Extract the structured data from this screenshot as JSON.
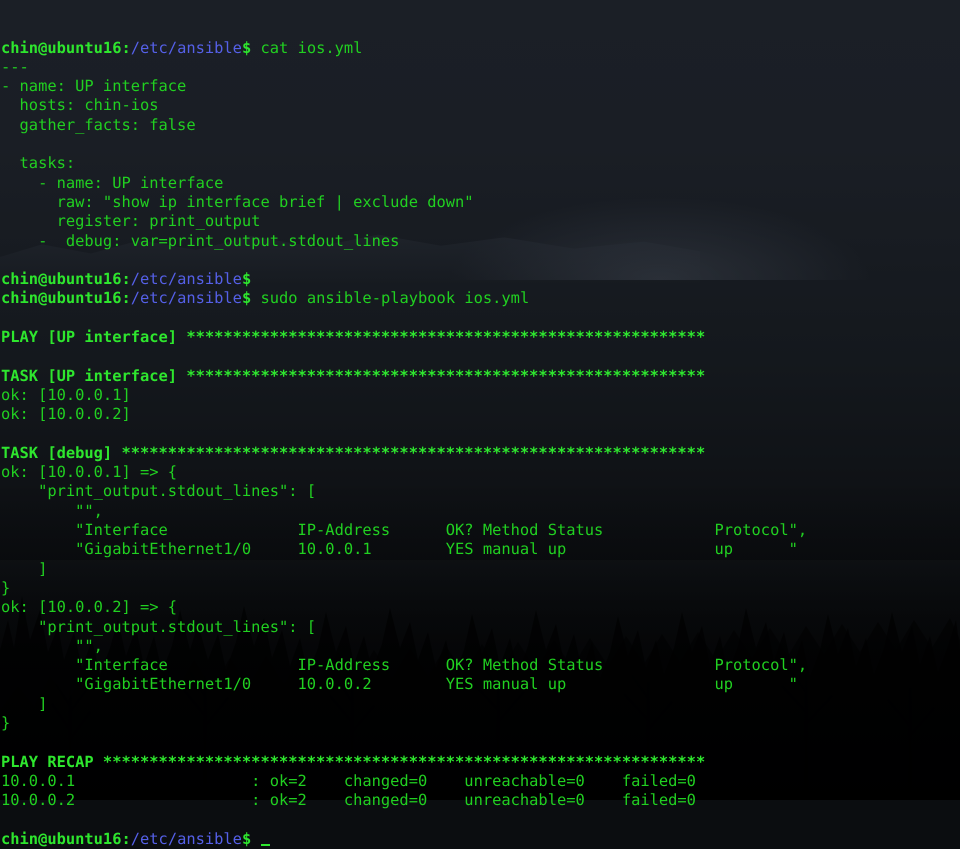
{
  "terminal": {
    "window_title": "chin@ubuntu16: /etc/ansible",
    "prompt": {
      "user_host": "chin@ubuntu16",
      "separator": ":",
      "path": "/etc/ansible",
      "symbol": "$"
    },
    "colors": {
      "foreground": "#21d021",
      "bold_green": "#2ee62e",
      "path_blue": "#5560e8",
      "background": "#0b0d10"
    },
    "cursor_glyph": "_",
    "commands": [
      "cat ios.yml",
      "sudo ansible-playbook ios.yml"
    ],
    "lines": [
      {
        "id": "l01",
        "type": "prompt",
        "command": " cat ios.yml"
      },
      {
        "id": "l02",
        "type": "out",
        "text": "---"
      },
      {
        "id": "l03",
        "type": "out",
        "text": "- name: UP interface"
      },
      {
        "id": "l04",
        "type": "out",
        "text": "  hosts: chin-ios"
      },
      {
        "id": "l05",
        "type": "out",
        "text": "  gather_facts: false"
      },
      {
        "id": "l06",
        "type": "out",
        "text": ""
      },
      {
        "id": "l07",
        "type": "out",
        "text": "  tasks:"
      },
      {
        "id": "l08",
        "type": "out",
        "text": "    - name: UP interface"
      },
      {
        "id": "l09",
        "type": "out",
        "text": "      raw: \"show ip interface brief | exclude down\""
      },
      {
        "id": "l10",
        "type": "out",
        "text": "      register: print_output"
      },
      {
        "id": "l11",
        "type": "out",
        "text": "    -  debug: var=print_output.stdout_lines"
      },
      {
        "id": "l12",
        "type": "out",
        "text": ""
      },
      {
        "id": "l13",
        "type": "prompt",
        "command": ""
      },
      {
        "id": "l14",
        "type": "prompt",
        "command": " sudo ansible-playbook ios.yml"
      },
      {
        "id": "l15",
        "type": "out",
        "text": ""
      },
      {
        "id": "l16",
        "type": "bold",
        "text": "PLAY [UP interface] ********************************************************"
      },
      {
        "id": "l17",
        "type": "out",
        "text": ""
      },
      {
        "id": "l18",
        "type": "bold",
        "text": "TASK [UP interface] ********************************************************"
      },
      {
        "id": "l19",
        "type": "out",
        "text": "ok: [10.0.0.1]"
      },
      {
        "id": "l20",
        "type": "out",
        "text": "ok: [10.0.0.2]"
      },
      {
        "id": "l21",
        "type": "out",
        "text": ""
      },
      {
        "id": "l22",
        "type": "bold",
        "text": "TASK [debug] ***************************************************************"
      },
      {
        "id": "l23",
        "type": "out",
        "text": "ok: [10.0.0.1] => {"
      },
      {
        "id": "l24",
        "type": "out",
        "text": "    \"print_output.stdout_lines\": ["
      },
      {
        "id": "l25",
        "type": "out",
        "text": "        \"\","
      },
      {
        "id": "l26",
        "type": "out",
        "text": "        \"Interface              IP-Address      OK? Method Status            Protocol\","
      },
      {
        "id": "l27",
        "type": "out",
        "text": "        \"GigabitEthernet1/0     10.0.0.1        YES manual up                up      \""
      },
      {
        "id": "l28",
        "type": "out",
        "text": "    ]"
      },
      {
        "id": "l29",
        "type": "out",
        "text": "}"
      },
      {
        "id": "l30",
        "type": "out",
        "text": "ok: [10.0.0.2] => {"
      },
      {
        "id": "l31",
        "type": "out",
        "text": "    \"print_output.stdout_lines\": ["
      },
      {
        "id": "l32",
        "type": "out",
        "text": "        \"\","
      },
      {
        "id": "l33",
        "type": "out",
        "text": "        \"Interface              IP-Address      OK? Method Status            Protocol\","
      },
      {
        "id": "l34",
        "type": "out",
        "text": "        \"GigabitEthernet1/0     10.0.0.2        YES manual up                up      \""
      },
      {
        "id": "l35",
        "type": "out",
        "text": "    ]"
      },
      {
        "id": "l36",
        "type": "out",
        "text": "}"
      },
      {
        "id": "l37",
        "type": "out",
        "text": ""
      },
      {
        "id": "l38",
        "type": "bold",
        "text": "PLAY RECAP *****************************************************************"
      },
      {
        "id": "l39",
        "type": "out",
        "text": "10.0.0.1                   : ok=2    changed=0    unreachable=0    failed=0"
      },
      {
        "id": "l40",
        "type": "out",
        "text": "10.0.0.2                   : ok=2    changed=0    unreachable=0    failed=0"
      },
      {
        "id": "l41",
        "type": "out",
        "text": ""
      },
      {
        "id": "l42",
        "type": "prompt",
        "command": " ",
        "cursor": true
      }
    ],
    "playbook": {
      "doc_start": "---",
      "play_name": "UP interface",
      "hosts": "chin-ios",
      "gather_facts": "false",
      "tasks": [
        {
          "name": "UP interface",
          "raw": "show ip interface brief | exclude down",
          "register": "print_output"
        },
        {
          "module": "debug",
          "args": "var=print_output.stdout_lines"
        }
      ]
    },
    "run_results": {
      "play": "UP interface",
      "tasks": [
        "UP interface",
        "debug"
      ],
      "hosts": [
        "10.0.0.1",
        "10.0.0.2"
      ],
      "interface_table": {
        "headers": [
          "Interface",
          "IP-Address",
          "OK?",
          "Method",
          "Status",
          "Protocol"
        ],
        "rows": [
          {
            "host": "10.0.0.1",
            "interface": "GigabitEthernet1/0",
            "ip": "10.0.0.1",
            "ok": "YES",
            "method": "manual",
            "status": "up",
            "protocol": "up"
          },
          {
            "host": "10.0.0.2",
            "interface": "GigabitEthernet1/0",
            "ip": "10.0.0.2",
            "ok": "YES",
            "method": "manual",
            "status": "up",
            "protocol": "up"
          }
        ]
      },
      "recap": [
        {
          "host": "10.0.0.1",
          "ok": "ok=2",
          "changed": "changed=0",
          "unreachable": "unreachable=0",
          "failed": "failed=0"
        },
        {
          "host": "10.0.0.2",
          "ok": "ok=2",
          "changed": "changed=0",
          "unreachable": "unreachable=0",
          "failed": "failed=0"
        }
      ]
    }
  }
}
